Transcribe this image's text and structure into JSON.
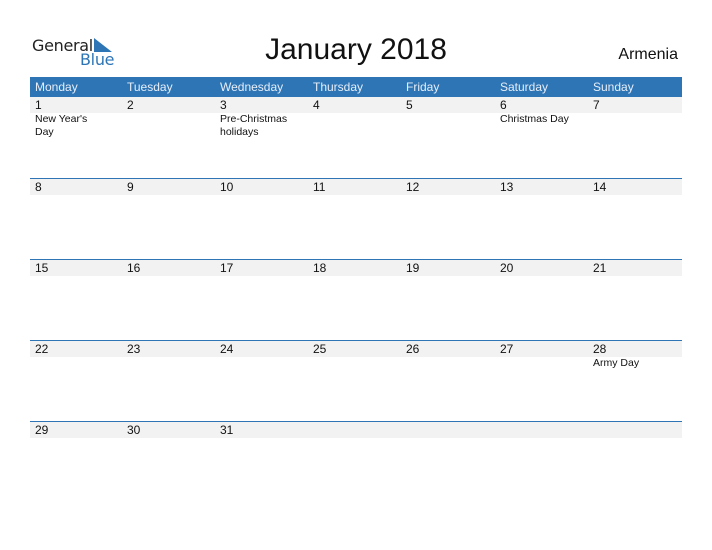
{
  "logo": {
    "word1": "General",
    "word2": "Blue",
    "icon": "triangle-flag-icon",
    "accent": "#2e75b6"
  },
  "title": "January 2018",
  "country": "Armenia",
  "colors": {
    "header_bg": "#2e75b6",
    "band_bg": "#f2f2f2",
    "separator": "#2e75b6"
  },
  "weekdays": [
    "Monday",
    "Tuesday",
    "Wednesday",
    "Thursday",
    "Friday",
    "Saturday",
    "Sunday"
  ],
  "weeks": [
    {
      "days": [
        {
          "num": "1",
          "event": "New Year's Day"
        },
        {
          "num": "2",
          "event": ""
        },
        {
          "num": "3",
          "event": "Pre-Christmas holidays"
        },
        {
          "num": "4",
          "event": ""
        },
        {
          "num": "5",
          "event": ""
        },
        {
          "num": "6",
          "event": "Christmas Day"
        },
        {
          "num": "7",
          "event": ""
        }
      ]
    },
    {
      "days": [
        {
          "num": "8",
          "event": ""
        },
        {
          "num": "9",
          "event": ""
        },
        {
          "num": "10",
          "event": ""
        },
        {
          "num": "11",
          "event": ""
        },
        {
          "num": "12",
          "event": ""
        },
        {
          "num": "13",
          "event": ""
        },
        {
          "num": "14",
          "event": ""
        }
      ]
    },
    {
      "days": [
        {
          "num": "15",
          "event": ""
        },
        {
          "num": "16",
          "event": ""
        },
        {
          "num": "17",
          "event": ""
        },
        {
          "num": "18",
          "event": ""
        },
        {
          "num": "19",
          "event": ""
        },
        {
          "num": "20",
          "event": ""
        },
        {
          "num": "21",
          "event": ""
        }
      ]
    },
    {
      "days": [
        {
          "num": "22",
          "event": ""
        },
        {
          "num": "23",
          "event": ""
        },
        {
          "num": "24",
          "event": ""
        },
        {
          "num": "25",
          "event": ""
        },
        {
          "num": "26",
          "event": ""
        },
        {
          "num": "27",
          "event": ""
        },
        {
          "num": "28",
          "event": "Army Day"
        }
      ]
    },
    {
      "days": [
        {
          "num": "29",
          "event": ""
        },
        {
          "num": "30",
          "event": ""
        },
        {
          "num": "31",
          "event": ""
        },
        {
          "num": "",
          "event": ""
        },
        {
          "num": "",
          "event": ""
        },
        {
          "num": "",
          "event": ""
        },
        {
          "num": "",
          "event": ""
        }
      ]
    }
  ]
}
